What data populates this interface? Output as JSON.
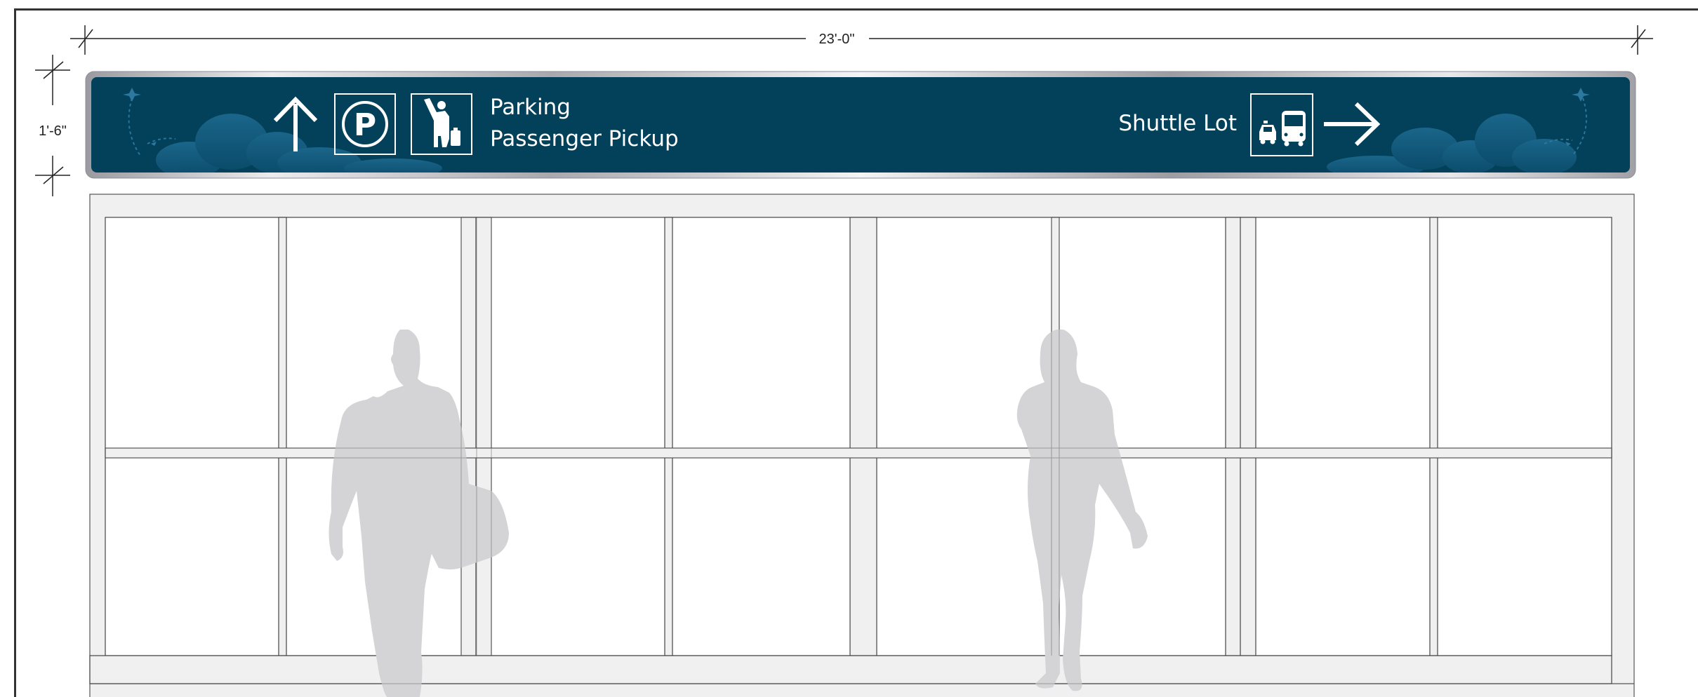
{
  "dimensions": {
    "width_label": "23'-0\"",
    "height_label": "1'-6\""
  },
  "sign": {
    "left_text_line1": "Parking",
    "left_text_line2": "Passenger Pickup",
    "right_text": "Shuttle Lot",
    "icons": [
      "up-arrow-icon",
      "parking-icon",
      "passenger-pickup-icon",
      "taxi-bus-icon",
      "right-arrow-icon"
    ],
    "colors": {
      "panel": "#034059",
      "frame": "#b8b8bd",
      "cloud": "#16577a",
      "text": "#ffffff"
    }
  },
  "storefront": {
    "colors": {
      "frame": "#f0f0f1",
      "line": "#444444",
      "silhouette": "#d4d4d6"
    }
  }
}
